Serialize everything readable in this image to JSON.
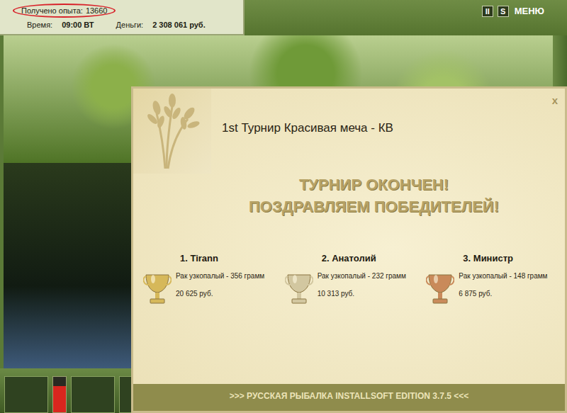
{
  "hud": {
    "experience": {
      "label": "Получено опыта:",
      "value": "13660"
    },
    "time": {
      "label": "Время:",
      "value": "09:00 ВТ"
    },
    "money": {
      "label": "Деньги:",
      "value": "2 308 061 руб."
    }
  },
  "top_buttons": [
    {
      "label": "II",
      "kind": "icon"
    },
    {
      "label": "S",
      "kind": "icon"
    },
    {
      "label": "МЕНЮ",
      "kind": "text"
    }
  ],
  "power_meter": {
    "level": 0.75
  },
  "dialog": {
    "title": "1st Турнир Красивая меча - КВ",
    "close": "x",
    "heading": [
      "ТУРНИР ОКОНЧЕН!",
      "ПОЗДРАВЛЯЕМ ПОБЕДИТЕЛЕЙ!"
    ],
    "winners": [
      {
        "place": "1. Tirann",
        "catch": "Рак узкопалый - 356 грамм",
        "prize": "20 625 руб.",
        "color": "#d6b85a"
      },
      {
        "place": "2. Анатолий",
        "catch": "Рак узкопалый - 232 грамм",
        "prize": "10 313 руб.",
        "color": "#d2c7a0"
      },
      {
        "place": "3. Министр",
        "catch": "Рак узкопалый - 148 грамм",
        "prize": "6 875 руб.",
        "color": "#c98a5a"
      }
    ],
    "footer": ">>> РУССКАЯ РЫБАЛКА INSTALLSOFT EDITION 3.7.5 <<<"
  }
}
